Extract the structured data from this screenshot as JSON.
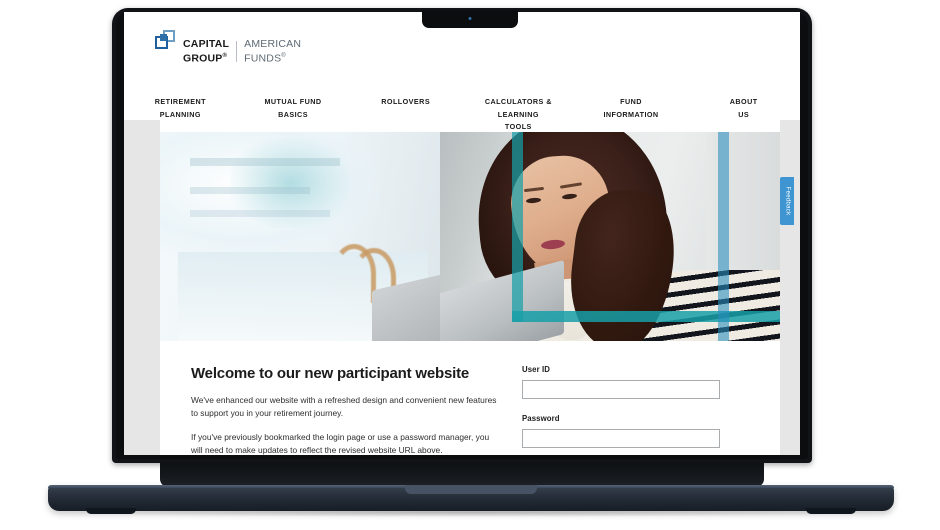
{
  "device": {
    "type": "laptop",
    "camera": "camera-dot"
  },
  "site": {
    "brand": {
      "mark": "capital-group-logo-icon",
      "name_line1": "CAPITAL",
      "name_line2": "GROUP",
      "registered": "®",
      "partner_line1": "AMERICAN",
      "partner_line2": "FUNDS",
      "partner_registered": "®"
    },
    "nav": [
      {
        "line1": "RETIREMENT",
        "line2": "PLANNING"
      },
      {
        "line1": "MUTUAL FUND",
        "line2": "BASICS"
      },
      {
        "line1": "ROLLOVERS",
        "line2": ""
      },
      {
        "line1": "CALCULATORS & LEARNING",
        "line2": "TOOLS"
      },
      {
        "line1": "FUND",
        "line2": "INFORMATION"
      },
      {
        "line1": "ABOUT",
        "line2": "US"
      }
    ],
    "hero": {
      "alt": "Woman working on a laptop in a bright office",
      "accent_color": "#17a0a8",
      "accent_color_2": "#288cbe"
    },
    "main": {
      "title": "Welcome to our new participant website",
      "paragraph1": "We've enhanced our website with a refreshed design and convenient new features to support you in your retirement journey.",
      "paragraph2": "If you've previously bookmarked the login page or use a password manager, you will need to make updates to reflect the revised website URL above."
    },
    "login": {
      "user_id_label": "User ID",
      "user_id_value": "",
      "user_id_placeholder": "",
      "password_label": "Password",
      "password_value": "",
      "password_placeholder": ""
    },
    "feedback": {
      "label": "Feedback",
      "color": "#3f95d2"
    },
    "colors": {
      "page_background": "#e6e6e6",
      "content_background": "#ffffff",
      "text": "#1b1b1b",
      "brand_blue": "#2f6fa8",
      "brand_blue_light": "#6f9ec4"
    }
  }
}
